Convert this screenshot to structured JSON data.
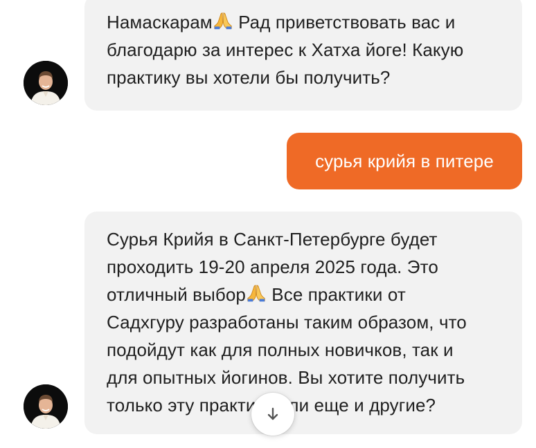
{
  "messages": [
    {
      "role": "bot",
      "lines": [
        {
          "before": "Намаскарам",
          "emoji": "folded-hands",
          "after": " Рад приветствовать вас и"
        },
        {
          "text": "благодарю за интерес к Хатха йоге! Какую"
        },
        {
          "text": "практику вы хотели бы получить?"
        }
      ]
    },
    {
      "role": "user",
      "text": "сурья крийя в питере"
    },
    {
      "role": "bot",
      "lines": [
        {
          "text": "Сурья Крийя в Санкт-Петербурге будет"
        },
        {
          "text": "проходить 19-20 апреля 2025 года. Это"
        },
        {
          "before": "отличный выбор",
          "emoji": "folded-hands",
          "after": " Все практики от"
        },
        {
          "text": "Садхгуру разработаны таким образом, что"
        },
        {
          "text": "подойдут как для полных новичков, так и"
        },
        {
          "text": "для опытных йогинов. Вы хотите получить"
        },
        {
          "text": "только эту практику или еще и другие?"
        }
      ]
    }
  ],
  "icons": {
    "scroll_down": "arrow-down-icon",
    "emoji": "folded-hands-emoji"
  },
  "colors": {
    "bot_bubble": "#f2f2f2",
    "user_bubble": "#ef6a26",
    "user_text": "#ffffff",
    "text": "#1f1f1f"
  }
}
